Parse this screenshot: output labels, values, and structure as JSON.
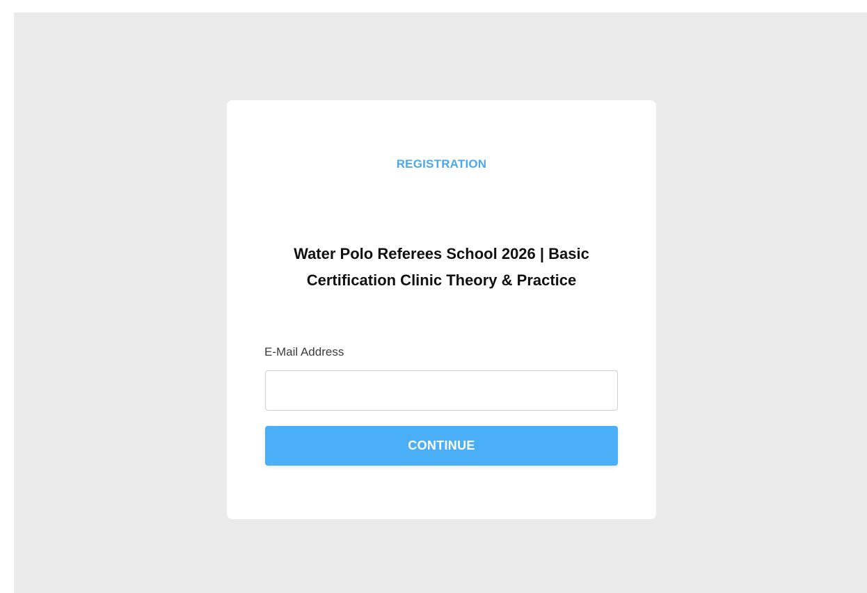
{
  "page": {
    "background_color": "#ebebeb",
    "card_color": "#ffffff",
    "accent_color": "#4baff8"
  },
  "registration": {
    "eyebrow": "REGISTRATION",
    "title": "Water Polo Referees School 2026 | Basic Certification Clinic Theory & Practice",
    "email_label": "E-Mail Address",
    "email_value": "",
    "email_placeholder": "",
    "continue_label": "CONTINUE"
  }
}
